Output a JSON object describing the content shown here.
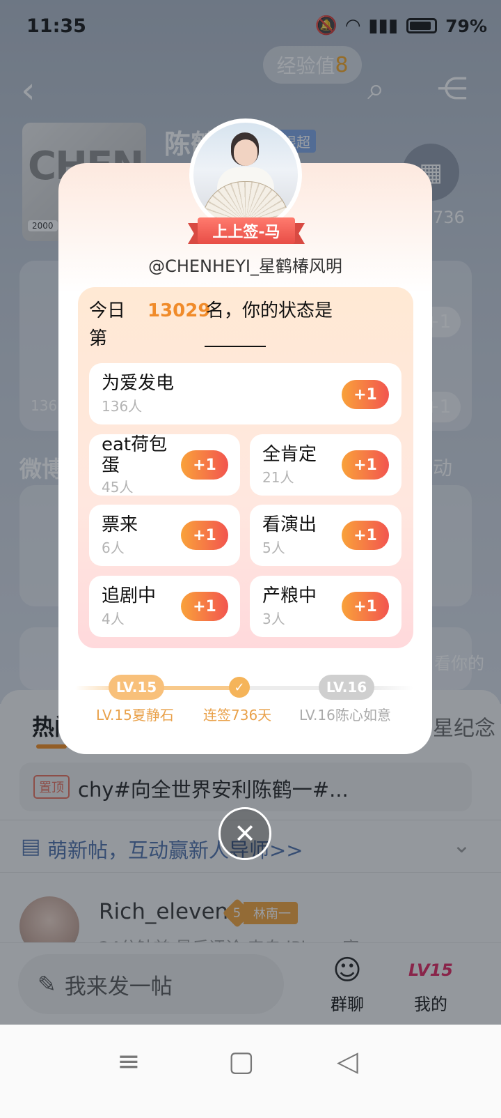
{
  "status": {
    "time": "11:35",
    "battery": "79%"
  },
  "header": {
    "exp_label": "经验值",
    "exp_value": "8",
    "title": "陈鹤",
    "badge": "根超",
    "streak_count": "736",
    "cover_text": "CHENHEYI",
    "cover_year": "2000"
  },
  "background": {
    "section_weibo": "微博",
    "side_count": "136",
    "plus_label": "+1",
    "active_label": "动",
    "side_text": "看你的"
  },
  "modal": {
    "fortune": "上上签-马",
    "handle": "@CHENHEYI_星鹤椿风明",
    "rank_prefix": "今日第",
    "rank_number": "13029",
    "rank_suffix": "名，你的状态是",
    "options": [
      {
        "label": "为爱发电",
        "count": "136人",
        "plus": "+1"
      },
      {
        "label": "eat荷包蛋",
        "count": "45人",
        "plus": "+1"
      },
      {
        "label": "全肯定",
        "count": "21人",
        "plus": "+1"
      },
      {
        "label": "票来",
        "count": "6人",
        "plus": "+1"
      },
      {
        "label": "看演出",
        "count": "5人",
        "plus": "+1"
      },
      {
        "label": "追剧中",
        "count": "4人",
        "plus": "+1"
      },
      {
        "label": "产粮中",
        "count": "3人",
        "plus": "+1"
      }
    ],
    "progress": {
      "current_level": "LV.15",
      "next_level": "LV.16",
      "current_name": "LV.15夏静石",
      "streak": "连签736天",
      "next_name": "LV.16陈心如意",
      "fraction": 0.5
    }
  },
  "feed": {
    "tab_hot": "热门",
    "tab_right": "星纪念",
    "pinned_badge": "置顶",
    "pinned_text": "chy#向全世界安利陈鹤一#...",
    "newbie_text": "萌新帖，互动赢新人导师>>",
    "post_user": "Rich_eleven",
    "post_level": "5",
    "post_level_name": "林南一",
    "post_meta": "24分钟前 最后评论 来自 iPhone客"
  },
  "action_bar": {
    "compose_label": "我来发一帖",
    "group_chat": "群聊",
    "mine": "我的",
    "mine_badge": "LV15"
  },
  "icons": {
    "accent": "#f08b2a",
    "plus_gradient": [
      "#f9a23a",
      "#f2554f"
    ]
  }
}
